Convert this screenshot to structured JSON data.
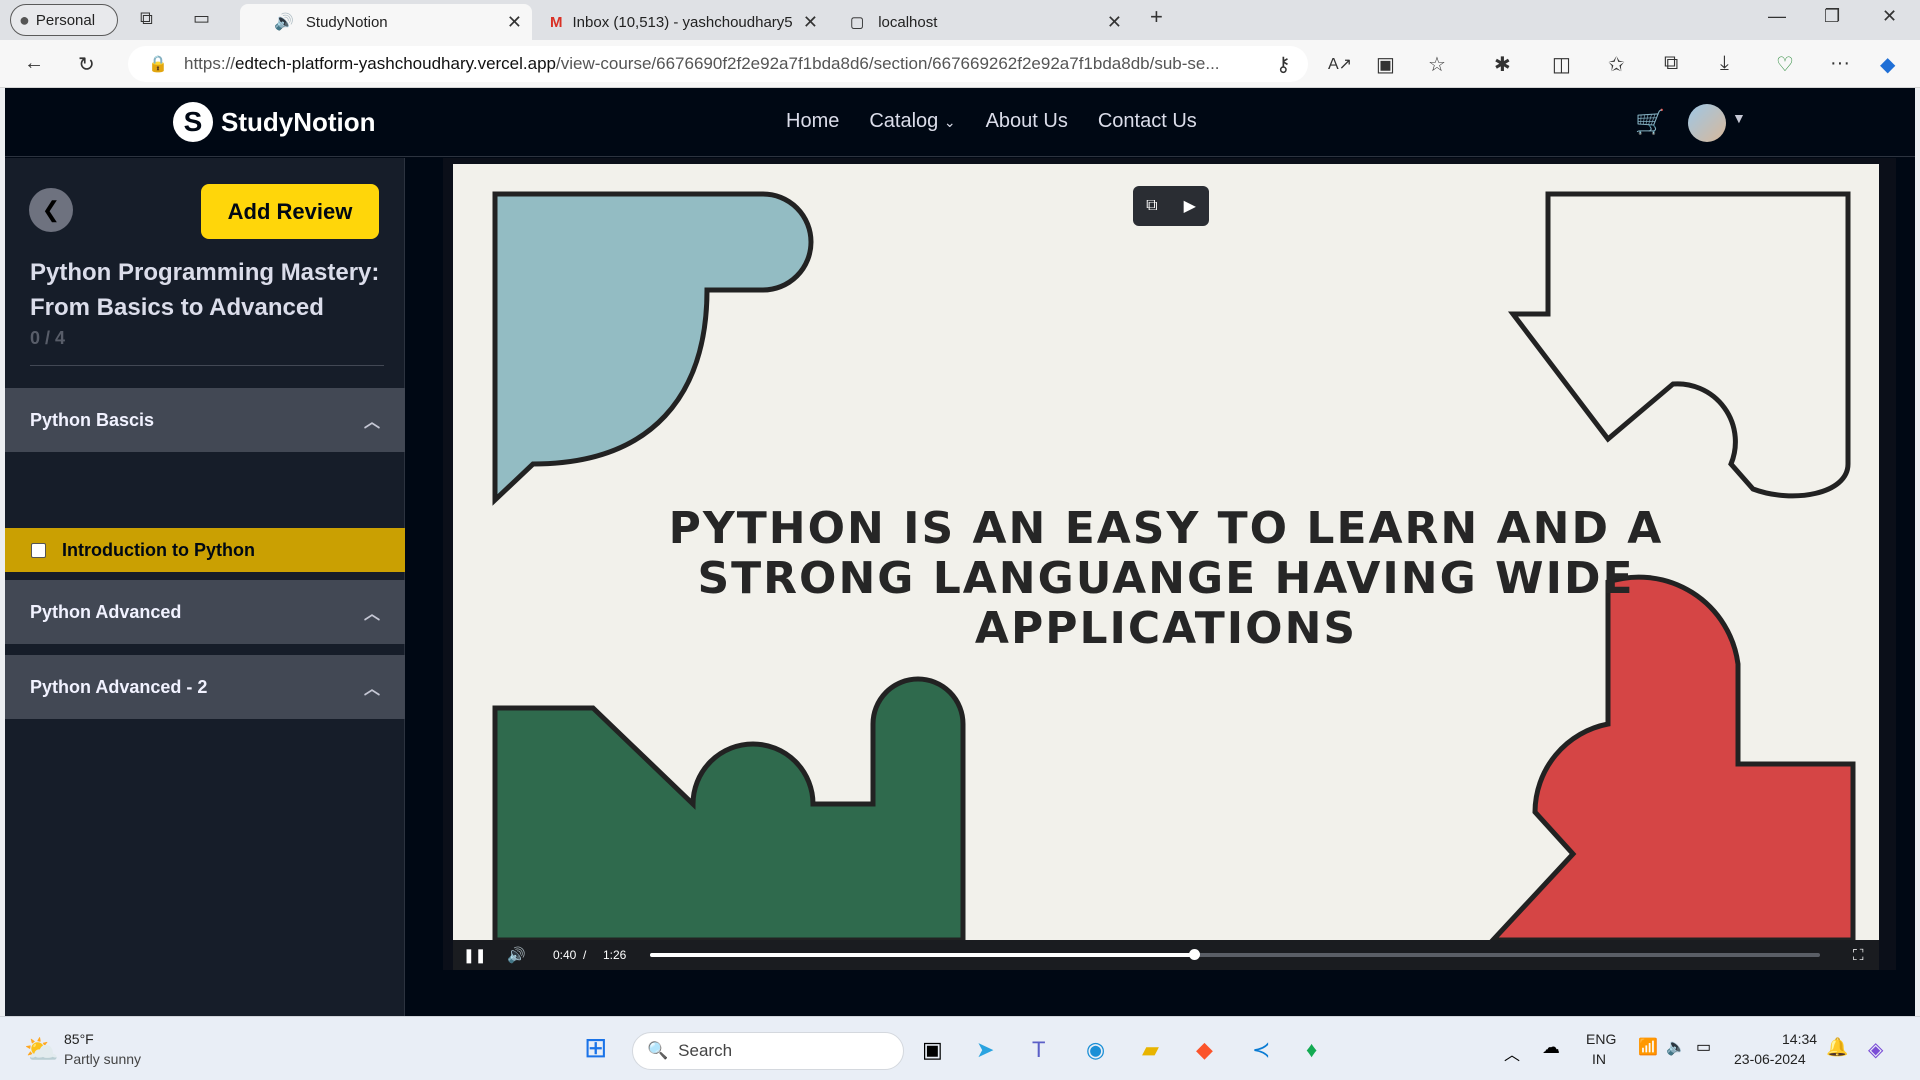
{
  "browser": {
    "profile": "Personal",
    "tabs": [
      {
        "title": "StudyNotion",
        "active": true
      },
      {
        "title": "Inbox (10,513) - yashchoudhary5",
        "active": false
      },
      {
        "title": "localhost",
        "active": false
      }
    ],
    "url_prefix": "https://",
    "url_domain": "edtech-platform-yashchoudhary.vercel.app",
    "url_path": "/view-course/6676690f2f2e92a7f1bda8d6/section/667669262f2e92a7f1bda8db/sub-se..."
  },
  "app": {
    "logo_letter": "S",
    "logo_text": "StudyNotion",
    "nav": {
      "home": "Home",
      "catalog": "Catalog",
      "about": "About Us",
      "contact": "Contact Us"
    }
  },
  "sidebar": {
    "add_review": "Add Review",
    "course_title": "Python Programming Mastery: From Basics to Advanced",
    "progress": "0 / 4",
    "sections": [
      {
        "title": "Python Bascis"
      },
      {
        "title": "Python Advanced"
      },
      {
        "title": "Python Advanced - 2"
      }
    ],
    "lesson": "Introduction to Python"
  },
  "video": {
    "overlay_text": "PYTHON IS AN EASY TO LEARN AND A STRONG LANGUANGE HAVING WIDE APPLICATIONS",
    "current_time": "0:40",
    "separator": "/",
    "duration": "1:26",
    "progress_fraction": 0.465
  },
  "taskbar": {
    "weather_temp": "85°F",
    "weather_desc": "Partly sunny",
    "search_placeholder": "Search",
    "lang_top": "ENG",
    "lang_bottom": "IN",
    "time": "14:34",
    "date": "23-06-2024"
  },
  "colors": {
    "accent": "#ffd60a",
    "lesson_bg": "#caa002",
    "sidebar_bg": "#161d29",
    "section_bg": "#424854"
  }
}
